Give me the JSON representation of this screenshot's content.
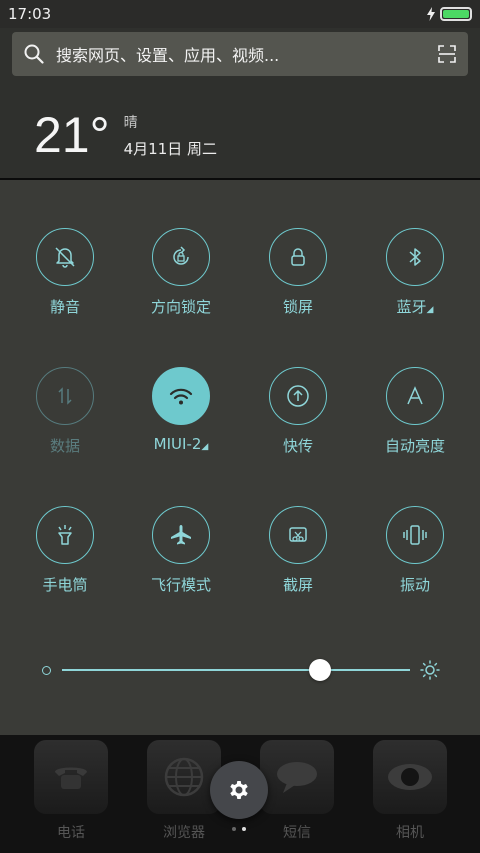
{
  "status_bar": {
    "time": "17:03",
    "battery_level": 1.0,
    "charging": true,
    "colors": {
      "battery": "#4cd964"
    }
  },
  "search": {
    "placeholder": "搜索网页、设置、应用、视频...",
    "left_icon": "search-icon",
    "right_icon": "scan-icon"
  },
  "weather": {
    "temperature": "21°",
    "condition": "晴",
    "date": "4月11日 周二"
  },
  "toggles": [
    {
      "label": "静音",
      "icon": "bell-off-icon",
      "state": "off"
    },
    {
      "label": "方向锁定",
      "icon": "rotation-lock-icon",
      "state": "off"
    },
    {
      "label": "锁屏",
      "icon": "lock-icon",
      "state": "off"
    },
    {
      "label": "蓝牙",
      "icon": "bluetooth-icon",
      "state": "off",
      "has_dropdown": true
    },
    {
      "label": "数据",
      "icon": "data-arrows-icon",
      "state": "disabled"
    },
    {
      "label": "MIUI-2",
      "icon": "wifi-icon",
      "state": "on",
      "has_dropdown": true
    },
    {
      "label": "快传",
      "icon": "quick-transfer-icon",
      "state": "off"
    },
    {
      "label": "自动亮度",
      "icon": "auto-brightness-icon",
      "state": "off"
    },
    {
      "label": "手电筒",
      "icon": "flashlight-icon",
      "state": "off"
    },
    {
      "label": "飞行模式",
      "icon": "airplane-icon",
      "state": "off"
    },
    {
      "label": "截屏",
      "icon": "screenshot-icon",
      "state": "off"
    },
    {
      "label": "振动",
      "icon": "vibrate-icon",
      "state": "off"
    }
  ],
  "brightness": {
    "level": 0.74
  },
  "dock": {
    "apps": [
      {
        "label": "电话",
        "icon": "phone-icon"
      },
      {
        "label": "浏览器",
        "icon": "globe-icon"
      },
      {
        "label": "短信",
        "icon": "message-icon"
      },
      {
        "label": "相机",
        "icon": "camera-icon"
      }
    ],
    "page_count": 2,
    "active_page": 1
  },
  "colors": {
    "accent": "#6ec9cd",
    "accent_label": "#8fd6d9",
    "panel_bg": "#3a3b37",
    "top_panel_bg": "#2f302d",
    "search_bg": "#54554f"
  }
}
